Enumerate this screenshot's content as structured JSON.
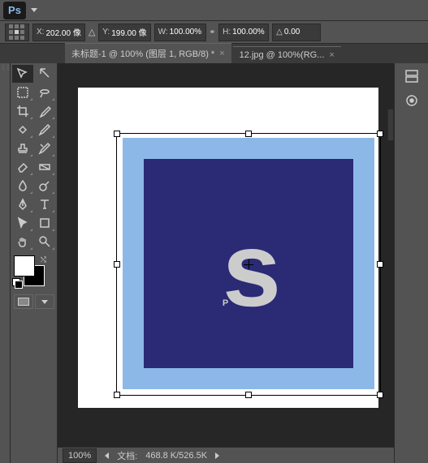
{
  "app": {
    "logo": "Ps"
  },
  "options": {
    "x_label": "X:",
    "x_value": "202.00 像",
    "y_label": "Y:",
    "y_value": "199.00 像",
    "w_label": "W:",
    "w_value": "100.00%",
    "h_label": "H:",
    "h_value": "100.00%",
    "angle_label": "△",
    "angle_value": "0.00"
  },
  "tabs": [
    {
      "title": "未标题-1 @ 100% (图层 1, RGB/8) *",
      "active": true
    },
    {
      "title": "12.jpg @ 100%(RG...",
      "active": false
    }
  ],
  "canvas": {
    "logo_text_p": "P",
    "logo_text_s": "s"
  },
  "status": {
    "zoom": "100%",
    "doc_label": "文档:",
    "doc_info": "468.8 K/526.5K"
  }
}
